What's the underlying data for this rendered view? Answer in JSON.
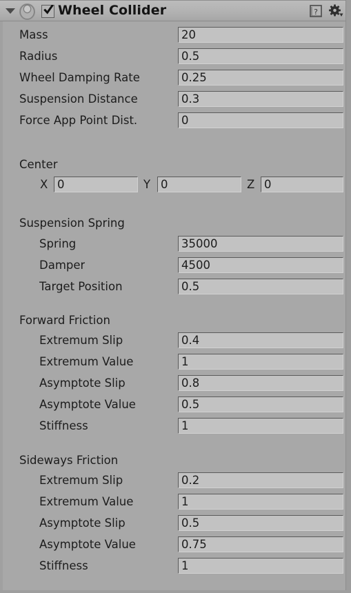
{
  "header": {
    "title": "Wheel Collider",
    "enabled_checkbox": true,
    "foldout_expanded": true,
    "icons": {
      "foldout": "triangle-down-icon",
      "component": "wheel-collider-icon",
      "checkbox": "checkbox-checked-icon",
      "help": "help-book-icon",
      "settings": "gear-dropdown-icon"
    }
  },
  "colors": {
    "panel_background": "#a8a8a8",
    "header_background": "#b4b4b4",
    "field_background": "#c2c2c2",
    "text": "#1c1c1c",
    "border": "#6e6e6e"
  },
  "properties": [
    {
      "label": "Mass",
      "value": "20"
    },
    {
      "label": "Radius",
      "value": "0.5"
    },
    {
      "label": "Wheel Damping Rate",
      "value": "0.25"
    },
    {
      "label": "Suspension Distance",
      "value": "0.3"
    },
    {
      "label": "Force App Point Dist.",
      "value": "0"
    }
  ],
  "center": {
    "label": "Center",
    "axes": [
      {
        "label": "X",
        "value": "0"
      },
      {
        "label": "Y",
        "value": "0"
      },
      {
        "label": "Z",
        "value": "0"
      }
    ]
  },
  "suspension_spring": {
    "label": "Suspension Spring",
    "items": [
      {
        "label": "Spring",
        "value": "35000"
      },
      {
        "label": "Damper",
        "value": "4500"
      },
      {
        "label": "Target Position",
        "value": "0.5"
      }
    ]
  },
  "forward_friction": {
    "label": "Forward Friction",
    "items": [
      {
        "label": "Extremum Slip",
        "value": "0.4"
      },
      {
        "label": "Extremum Value",
        "value": "1"
      },
      {
        "label": "Asymptote Slip",
        "value": "0.8"
      },
      {
        "label": "Asymptote Value",
        "value": "0.5"
      },
      {
        "label": "Stiffness",
        "value": "1"
      }
    ]
  },
  "sideways_friction": {
    "label": "Sideways Friction",
    "items": [
      {
        "label": "Extremum Slip",
        "value": "0.2"
      },
      {
        "label": "Extremum Value",
        "value": "1"
      },
      {
        "label": "Asymptote Slip",
        "value": "0.5"
      },
      {
        "label": "Asymptote Value",
        "value": "0.75"
      },
      {
        "label": "Stiffness",
        "value": "1"
      }
    ]
  }
}
